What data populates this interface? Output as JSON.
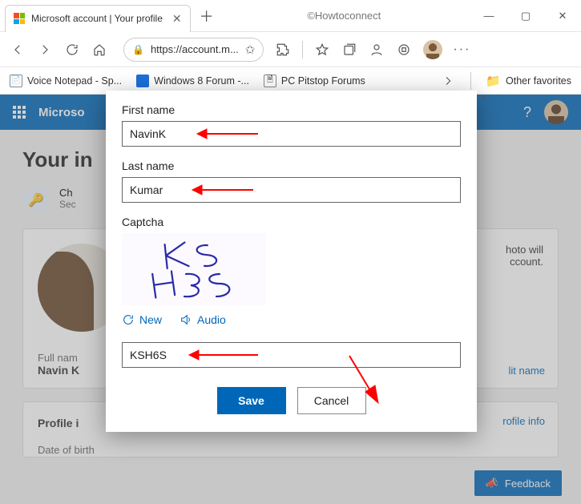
{
  "watermark": "©Howtoconnect",
  "tab": {
    "title": "Microsoft account | Your profile"
  },
  "toolbar": {
    "url": "https://account.m..."
  },
  "bookmarks": {
    "items": [
      {
        "label": "Voice Notepad - Sp..."
      },
      {
        "label": "Windows 8 Forum -..."
      },
      {
        "label": "PC Pitstop Forums"
      }
    ],
    "other": "Other favorites"
  },
  "header": {
    "brand": "Microso"
  },
  "page": {
    "heading": "Your in",
    "tip_title": "Ch",
    "tip_sub": "Sec",
    "photo_hint1": "hoto will",
    "photo_hint2": "ccount.",
    "fullname_label": "Full nam",
    "fullname_value": "Navin K",
    "editname": "lit name",
    "profile_label": "Profile i",
    "profile_editinfo": "rofile info",
    "dob_label": "Date of birth",
    "feedback": "Feedback"
  },
  "modal": {
    "first_name_label": "First name",
    "first_name_value": "NavinK",
    "last_name_label": "Last name",
    "last_name_value": "Kumar",
    "captcha_label": "Captcha",
    "captcha_text": "KSH6S",
    "new_label": "New",
    "audio_label": "Audio",
    "captcha_input_value": "KSH6S",
    "save": "Save",
    "cancel": "Cancel"
  }
}
